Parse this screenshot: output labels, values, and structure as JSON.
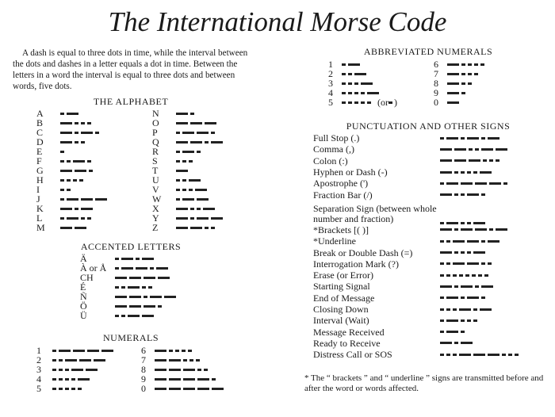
{
  "title": "The International Morse Code",
  "intro": "A dash is equal to three dots in time, while the interval between the dots and dashes in a letter equals a dot in time.  Between the letters in a word the interval is equal to three dots and between words, five dots.",
  "alphabet": {
    "heading": "THE ALPHABET",
    "left": [
      [
        "A",
        ".-"
      ],
      [
        "B",
        "-..."
      ],
      [
        "C",
        "-.-."
      ],
      [
        "D",
        "-.."
      ],
      [
        "E",
        "."
      ],
      [
        "F",
        "..-."
      ],
      [
        "G",
        "--."
      ],
      [
        "H",
        "...."
      ],
      [
        "I",
        ".."
      ],
      [
        "J",
        ".---"
      ],
      [
        "K",
        "-.-"
      ],
      [
        "L",
        ".-.."
      ],
      [
        "M",
        "--"
      ]
    ],
    "right": [
      [
        "N",
        "-."
      ],
      [
        "O",
        "---"
      ],
      [
        "P",
        ".--."
      ],
      [
        "Q",
        "--.-"
      ],
      [
        "R",
        ".-."
      ],
      [
        "S",
        "..."
      ],
      [
        "T",
        "-"
      ],
      [
        "U",
        "..-"
      ],
      [
        "V",
        "...-"
      ],
      [
        "W",
        ".--"
      ],
      [
        "X",
        "-..-"
      ],
      [
        "Y",
        "-.--"
      ],
      [
        "Z",
        "--.."
      ]
    ]
  },
  "accented": {
    "heading": "ACCENTED LETTERS",
    "items": [
      [
        "Ä",
        ".-.-"
      ],
      [
        "À or Å",
        ".--.-"
      ],
      [
        "CH",
        "----"
      ],
      [
        "É",
        "..-.."
      ],
      [
        "Ñ",
        "--.--"
      ],
      [
        "Ö",
        "---."
      ],
      [
        "Ü",
        "..--"
      ]
    ]
  },
  "numerals": {
    "heading": "NUMERALS",
    "left": [
      [
        "1",
        ".----"
      ],
      [
        "2",
        "..---"
      ],
      [
        "3",
        "...--"
      ],
      [
        "4",
        "....-"
      ],
      [
        "5",
        "....."
      ]
    ],
    "right": [
      [
        "6",
        "-...."
      ],
      [
        "7",
        "--..."
      ],
      [
        "8",
        "---.."
      ],
      [
        "9",
        "----."
      ],
      [
        "0",
        "-----"
      ]
    ]
  },
  "abbreviated": {
    "heading": "ABBREVIATED NUMERALS",
    "left": [
      [
        "1",
        ".-"
      ],
      [
        "2",
        "..-"
      ],
      [
        "3",
        "...-"
      ],
      [
        "4",
        "....-"
      ],
      [
        "5",
        "....."
      ]
    ],
    "five_suffix": "(or",
    "five_alt": ".",
    "five_close": ")",
    "right": [
      [
        "6",
        "-...."
      ],
      [
        "7",
        "-..."
      ],
      [
        "8",
        "-.."
      ],
      [
        "9",
        "-."
      ],
      [
        "0",
        "-"
      ]
    ]
  },
  "punctuation": {
    "heading": "PUNCTUATION AND OTHER SIGNS",
    "items": [
      [
        "Full Stop (.)",
        ".-.-.-"
      ],
      [
        "Comma (,)",
        "--..--"
      ],
      [
        "Colon (:)",
        "---..."
      ],
      [
        "Hyphen or Dash (-)",
        "-....-"
      ],
      [
        "Apostrophe (')",
        ".----."
      ],
      [
        "Fraction Bar (/)",
        "-..-."
      ],
      [
        "Separation Sign (between whole number and fraction)",
        ".-..-"
      ],
      [
        "*Brackets [( )]",
        "-.--.-"
      ],
      [
        "*Underline",
        "..--.-"
      ],
      [
        "Break or Double Dash (=)",
        "-...-"
      ],
      [
        "Interrogation Mark (?)",
        "..--.."
      ],
      [
        "Erase (or Error)",
        "........"
      ],
      [
        "Starting Signal",
        "-.-.-"
      ],
      [
        "End of Message",
        ".-.-."
      ],
      [
        "Closing Down",
        "...-.-"
      ],
      [
        "Interval (Wait)",
        ".-..."
      ],
      [
        "Message Received",
        ".-."
      ],
      [
        "Ready to Receive",
        "-.-"
      ],
      [
        "Distress Call or SOS",
        "...---..."
      ]
    ]
  },
  "footnote": "* The “ brackets ” and “ underline ” signs are transmitted before and after the word or words affected."
}
